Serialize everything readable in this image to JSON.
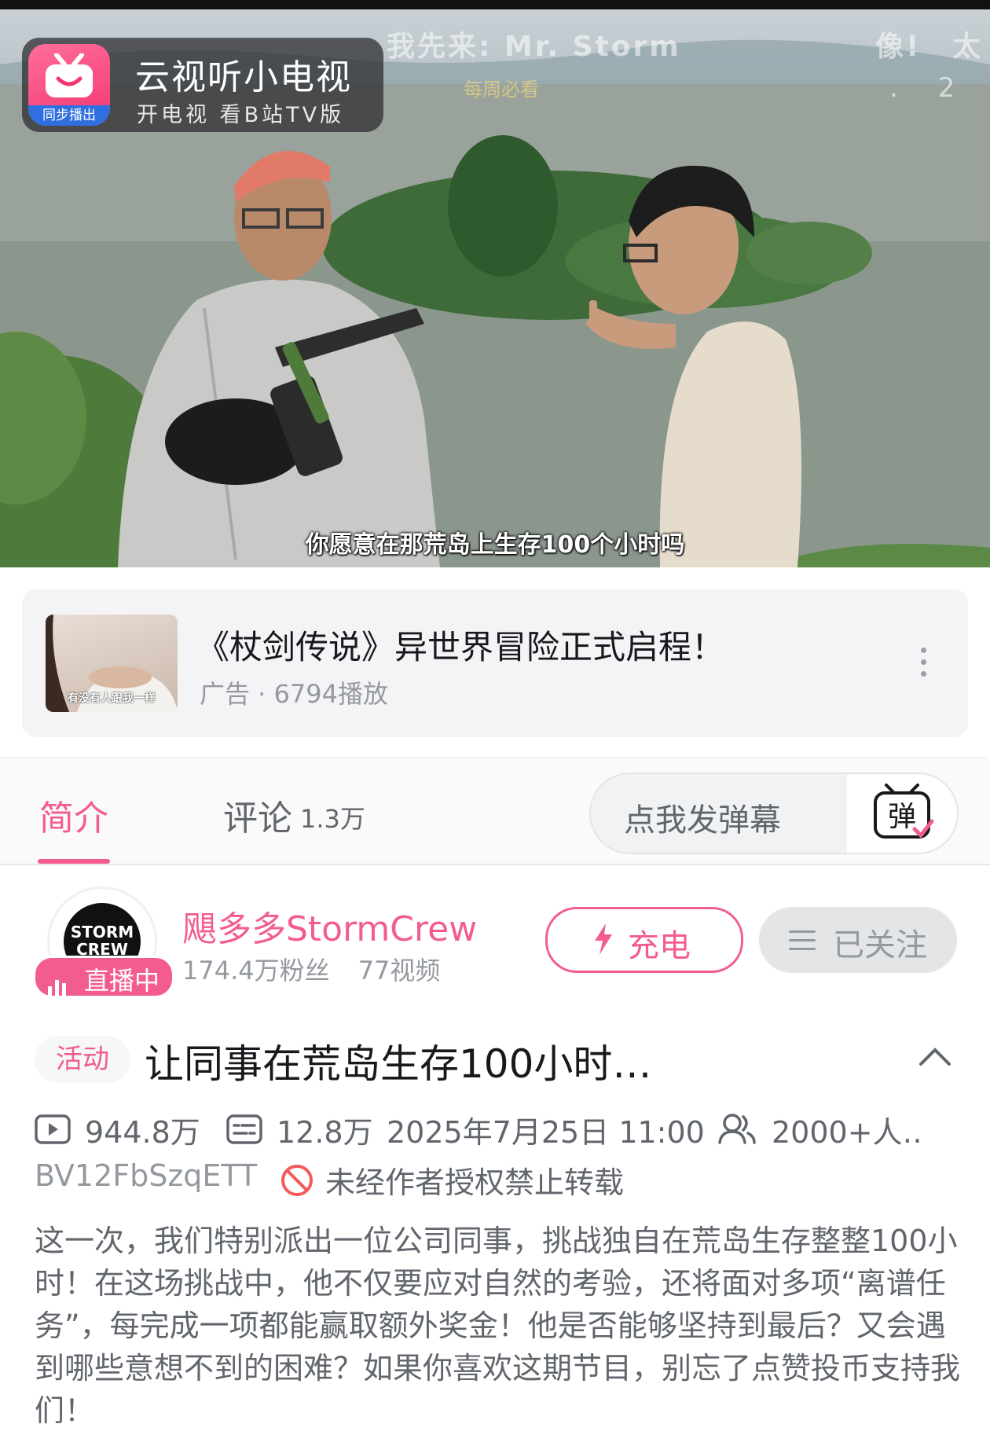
{
  "overlay": {
    "app_title": "云视听小电视",
    "app_subtitle": "开电视 看B站TV版",
    "sync_label": "同步播出",
    "danmaku": [
      "我先来: Mr. Storm",
      "像!",
      "太"
    ],
    "danmaku_small": "每周必看",
    "danmaku_num": ". 2",
    "subtitle": "你愿意在那荒岛上生存100个小时吗"
  },
  "ad": {
    "thumb_caption": "有没有人跟我一样",
    "title": "《杖剑传说》异世界冒险正式启程！",
    "meta": "广告 · 6794播放"
  },
  "tabs": {
    "intro": "简介",
    "comments": "评论",
    "comments_count": "1.3万",
    "danmaku_placeholder": "点我发弹幕",
    "danmaku_button_glyph": "弹"
  },
  "uploader": {
    "avatar_text": "STORM CREW",
    "live_label": "直播中",
    "name": "飓多多StormCrew",
    "fans": "174.4万粉丝",
    "videos": "77视频",
    "charge_label": "充电",
    "follow_label": "已关注"
  },
  "video": {
    "tag": "活动",
    "title": "让同事在荒岛生存100小时…",
    "views": "944.8万",
    "danmaku_count": "12.8万",
    "date": "2025年7月25日 11:00",
    "watching": "2000+人‥",
    "bvid": "BV12FbSzqETT",
    "copyright": "未经作者授权禁止转载",
    "description": "这一次，我们特别派出一位公司同事，挑战独自在荒岛生存整整100小时！在这场挑战中，他不仅要应对自然的考验，还将面对多项“离谱任务”，每完成一项都能赢取额外奖金！他是否能够坚持到最后？又会遇到哪些意想不到的困难？如果你喜欢这期节目，别忘了点赞投币支持我们！"
  },
  "colors": {
    "accent": "#f25d8e",
    "text_primary": "#18191c",
    "text_secondary": "#61666d",
    "text_muted": "#9499a0"
  }
}
